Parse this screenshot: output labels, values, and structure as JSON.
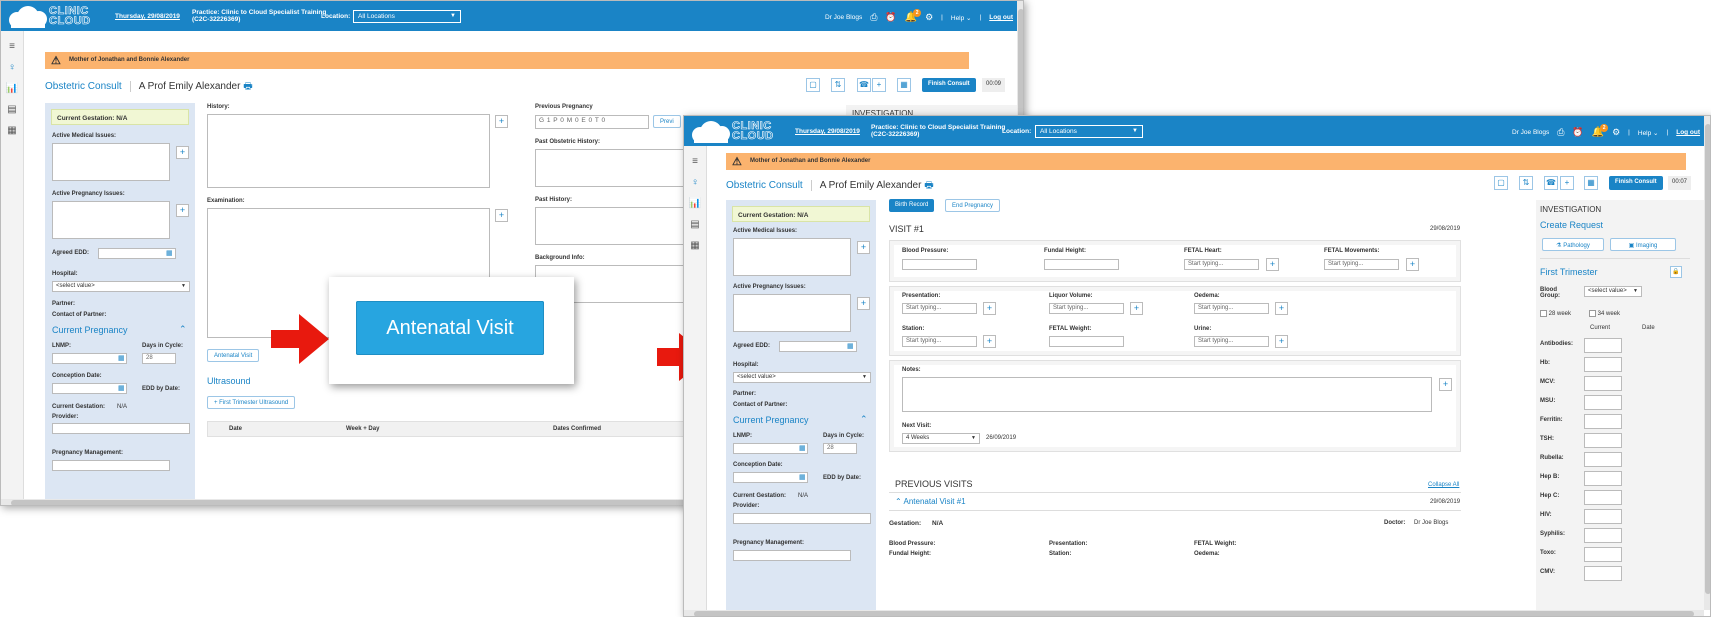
{
  "app": {
    "logo_line1": "CLINIC",
    "logo_line2": "CLOUD",
    "date": "Thursday, 29/08/2019",
    "practice_line1": "Practice: Clinic to Cloud Specialist Training",
    "practice_line2": "(C2C-32226369)",
    "location_label": "Location:",
    "location_value": "All Locations",
    "user": "Dr Joe Blogs",
    "notifications": "2",
    "help": "Help",
    "logout": "Log out"
  },
  "alert": "Mother of Jonathan and Bonnie Alexander",
  "consult": {
    "title": "Obstetric Consult",
    "patient": "A Prof Emily Alexander",
    "finish": "Finish Consult",
    "timer1": "00:09",
    "timer2": "00:07"
  },
  "left": {
    "gestation": "Current Gestation: N/A",
    "active_medical": "Active Medical Issues:",
    "active_pregnancy": "Active Pregnancy Issues:",
    "agreed_edd": "Agreed EDD:",
    "hospital": "Hospital:",
    "hospital_select": "<select value>",
    "partner": "Partner:",
    "contact_partner": "Contact of Partner:",
    "current_pregnancy": "Current Pregnancy",
    "lnmp": "LNMP:",
    "days_cycle": "Days in Cycle:",
    "days_value": "28",
    "conception": "Conception Date:",
    "edd_by_date": "EDD by Date:",
    "curr_gest_label": "Current Gestation:",
    "curr_gest_value": "N/A",
    "provider": "Provider:",
    "pregnancy_mgmt": "Pregnancy Management:"
  },
  "w1": {
    "history": "History:",
    "examination": "Examination:",
    "previous_pregnancy": "Previous Pregnancy",
    "gpmet": "G 1   P 0   M 0   E 0   T 0",
    "prev_btn": "Previ",
    "past_obstetric": "Past Obstetric History:",
    "past_history": "Past History:",
    "background": "Background Info:",
    "antenatal_small": "Antenatal Visit",
    "ultrasound": "Ultrasound",
    "first_trimester_us": "First Trimester Ultrasound",
    "investigation": "INVESTIGATION",
    "table_headers": [
      "Date",
      "Week + Day",
      "Dates Confirmed"
    ]
  },
  "banner": "Antenatal Visit",
  "w2": {
    "birth_record": "Birth Record",
    "end_pregnancy": "End Pregnancy",
    "visit": "VISIT #1",
    "visit_date": "29/08/2019",
    "blood_pressure": "Blood Pressure:",
    "fundal_height": "Fundal Height:",
    "fetal_heart": "FETAL Heart:",
    "fetal_movements": "FETAL Movements:",
    "start_typing": "Start typing...",
    "presentation": "Presentation:",
    "liquor_volume": "Liquor Volume:",
    "oedema": "Oedema:",
    "station": "Station:",
    "fetal_weight": "FETAL Weight:",
    "urine": "Urine:",
    "notes": "Notes:",
    "next_visit": "Next Visit:",
    "next_visit_value": "4 Weeks",
    "next_visit_date": "26/09/2019",
    "previous_visits": "PREVIOUS VISITS",
    "collapse_all": "Collapse All",
    "antenatal_visit_1": "Antenatal Visit #1",
    "av1_date": "29/08/2019",
    "gestation": "Gestation:",
    "gestation_value": "N/A",
    "doctor": "Doctor:",
    "doctor_value": "Dr Joe Blogs",
    "pv_blood_pressure": "Blood Pressure:",
    "pv_fundal": "Fundal Height:",
    "pv_presentation": "Presentation:",
    "pv_station": "Station:",
    "pv_fetal_weight": "FETAL Weight:",
    "pv_oedema": "Oedema:"
  },
  "investigation": {
    "title": "INVESTIGATION",
    "create_request": "Create Request",
    "pathology": "Pathology",
    "imaging": "Imaging",
    "first_trimester": "First Trimester",
    "blood_group": "Blood Group:",
    "blood_group_value": "<select value>",
    "week28": "28 week",
    "week34": "34 week",
    "current": "Current",
    "date": "Date",
    "tests": [
      "Antibodies:",
      "Hb:",
      "MCV:",
      "MSU:",
      "Ferritin:",
      "TSH:",
      "Rubella:",
      "Hep B:",
      "Hep C:",
      "HIV:",
      "Syphilis:",
      "Toxo:",
      "CMV:"
    ]
  },
  "icons": {
    "menu": "menu-icon",
    "bell": "bell-icon",
    "gear": "gear-icon",
    "alarm": "alarm-icon",
    "inbox": "inbox-icon",
    "print": "print-icon",
    "calendar": "calendar-icon",
    "phone": "phone-icon",
    "chat": "chat-icon",
    "warning": "warning-icon"
  },
  "colors": {
    "primary": "#1a84c6",
    "alert": "#fbb36e",
    "panel": "#dce6f3",
    "arrow": "#e8190e",
    "banner": "#27a5e0"
  }
}
